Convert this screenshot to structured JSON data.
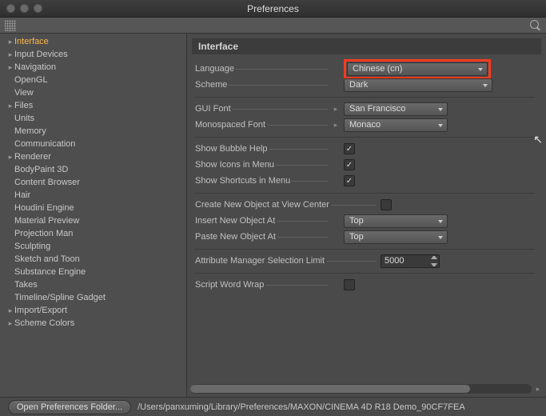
{
  "window": {
    "title": "Preferences"
  },
  "sidebar": {
    "items": [
      {
        "label": "Interface",
        "arrow": "▸",
        "selected": true
      },
      {
        "label": "Input Devices",
        "arrow": "▸"
      },
      {
        "label": "Navigation",
        "arrow": "▸"
      },
      {
        "label": "OpenGL",
        "arrow": ""
      },
      {
        "label": "View",
        "arrow": ""
      },
      {
        "label": "Files",
        "arrow": "▸"
      },
      {
        "label": "Units",
        "arrow": ""
      },
      {
        "label": "Memory",
        "arrow": ""
      },
      {
        "label": "Communication",
        "arrow": ""
      },
      {
        "label": "Renderer",
        "arrow": "▸"
      },
      {
        "label": "BodyPaint 3D",
        "arrow": ""
      },
      {
        "label": "Content Browser",
        "arrow": ""
      },
      {
        "label": "Hair",
        "arrow": ""
      },
      {
        "label": "Houdini Engine",
        "arrow": ""
      },
      {
        "label": "Material Preview",
        "arrow": ""
      },
      {
        "label": "Projection Man",
        "arrow": ""
      },
      {
        "label": "Sculpting",
        "arrow": ""
      },
      {
        "label": "Sketch and Toon",
        "arrow": ""
      },
      {
        "label": "Substance Engine",
        "arrow": ""
      },
      {
        "label": "Takes",
        "arrow": ""
      },
      {
        "label": "Timeline/Spline Gadget",
        "arrow": ""
      },
      {
        "label": "Import/Export",
        "arrow": "▸"
      },
      {
        "label": "Scheme Colors",
        "arrow": "▸"
      }
    ]
  },
  "panel": {
    "title": "Interface",
    "language": {
      "label": "Language",
      "value": "Chinese (cn)"
    },
    "scheme": {
      "label": "Scheme",
      "value": "Dark"
    },
    "guiFont": {
      "label": "GUI Font",
      "value": "San Francisco"
    },
    "monoFont": {
      "label": "Monospaced Font",
      "value": "Monaco"
    },
    "showBubble": {
      "label": "Show Bubble Help",
      "checked": true
    },
    "showIcons": {
      "label": "Show Icons in Menu",
      "checked": true
    },
    "showShort": {
      "label": "Show Shortcuts in Menu",
      "checked": true
    },
    "createCenter": {
      "label": "Create New Object at View Center",
      "checked": false
    },
    "insertAt": {
      "label": "Insert New Object At",
      "value": "Top"
    },
    "pasteAt": {
      "label": "Paste New Object At",
      "value": "Top"
    },
    "attrLimit": {
      "label": "Attribute Manager Selection Limit",
      "value": "5000"
    },
    "scriptWrap": {
      "label": "Script Word Wrap",
      "checked": false
    }
  },
  "footer": {
    "button": "Open Preferences Folder...",
    "path": "/Users/panxuming/Library/Preferences/MAXON/CINEMA 4D R18 Demo_90CF7FEA"
  }
}
